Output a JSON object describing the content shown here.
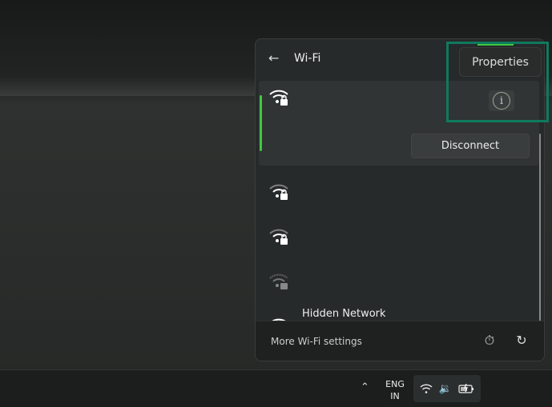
{
  "panel": {
    "title": "Wi-Fi",
    "back_icon": "arrow-left-icon",
    "networks": [
      {
        "name": "",
        "secured": true,
        "connected": true,
        "signal": "full"
      },
      {
        "name": "",
        "secured": true,
        "signal": "medium"
      },
      {
        "name": "",
        "secured": true,
        "signal": "medium"
      },
      {
        "name": "",
        "secured": true,
        "signal": "weak"
      },
      {
        "name": "Hidden Network",
        "secured": false,
        "signal": "full"
      }
    ],
    "disconnect_label": "Disconnect",
    "properties_tooltip": "Properties",
    "footer": {
      "more_settings": "More Wi-Fi settings"
    }
  },
  "taskbar": {
    "lang_line1": "ENG",
    "lang_line2": "IN"
  },
  "colors": {
    "accent": "#3ec93e",
    "highlight": "#0f7a5e"
  }
}
